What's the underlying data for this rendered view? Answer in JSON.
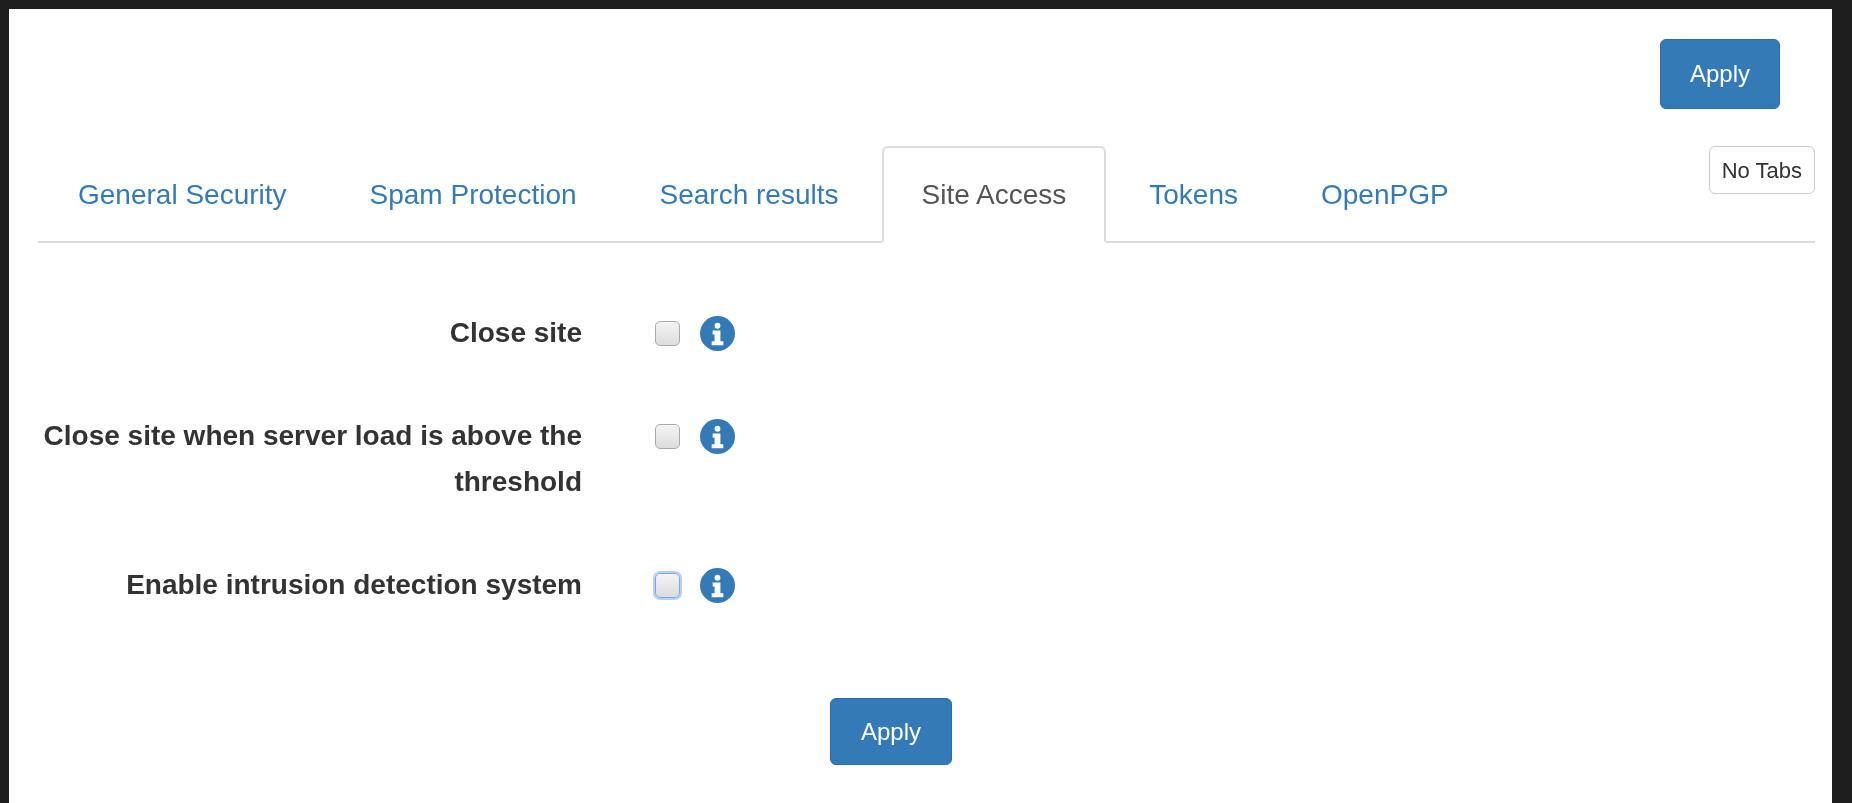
{
  "top_button": "Apply",
  "no_tabs_button": "No Tabs",
  "tabs": [
    {
      "label": "General Security",
      "selected": false
    },
    {
      "label": "Spam Protection",
      "selected": false
    },
    {
      "label": "Search results",
      "selected": false
    },
    {
      "label": "Site Access",
      "selected": true
    },
    {
      "label": "Tokens",
      "selected": false
    },
    {
      "label": "OpenPGP",
      "selected": false
    }
  ],
  "settings": [
    {
      "label": "Close site",
      "checked": false,
      "focused": false
    },
    {
      "label": "Close site when server load is above the threshold",
      "checked": false,
      "focused": false
    },
    {
      "label": "Enable intrusion detection system",
      "checked": false,
      "focused": true
    }
  ],
  "bottom_button": "Apply"
}
